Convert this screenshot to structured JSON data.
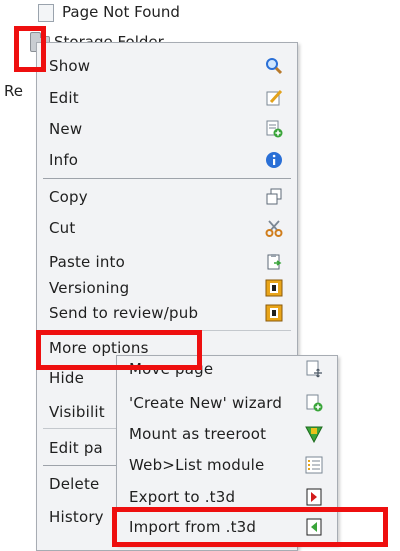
{
  "tree": {
    "page_not_found": "Page Not Found",
    "storage_folder": "Storage Folder",
    "side_label": "Re"
  },
  "context_menu": {
    "items": [
      {
        "label": "Show",
        "icon": "magnifier-icon"
      },
      {
        "label": "Edit",
        "icon": "pencil-icon"
      },
      {
        "label": "New",
        "icon": "new-page-icon"
      },
      {
        "label": "Info",
        "icon": "info-icon"
      },
      {
        "label": "Copy",
        "icon": "copy-icon"
      },
      {
        "label": "Cut",
        "icon": "scissors-icon"
      },
      {
        "label": "Paste into",
        "icon": "paste-icon"
      },
      {
        "label": "Versioning",
        "icon": "versioning-icon"
      },
      {
        "label": "Send to review/pub",
        "icon": "workspace-icon"
      },
      {
        "label": "More options",
        "icon": ""
      },
      {
        "label": "Hide",
        "icon": ""
      },
      {
        "label": "Visibilit",
        "icon": ""
      },
      {
        "label": "Edit pa",
        "icon": ""
      },
      {
        "label": "Delete",
        "icon": ""
      },
      {
        "label": "History",
        "icon": ""
      }
    ]
  },
  "submenu": {
    "items": [
      {
        "label": "Move page",
        "icon": "move-page-icon"
      },
      {
        "label": "'Create New' wizard",
        "icon": "new-wizard-icon"
      },
      {
        "label": "Mount as treeroot",
        "icon": "treeroot-icon"
      },
      {
        "label": "Web>List module",
        "icon": "list-module-icon"
      },
      {
        "label": "Export to .t3d",
        "icon": "export-icon"
      },
      {
        "label": "Import from .t3d",
        "icon": "import-icon"
      }
    ]
  },
  "colors": {
    "highlight": "#ee0f0f",
    "menu_bg": "#f2f3f5",
    "info_blue": "#2a6fd6",
    "add_green": "#3aa53a",
    "scissors_orange": "#d07d1c",
    "workspace_orange": "#e9a51a",
    "export_red": "#d21b1b"
  }
}
